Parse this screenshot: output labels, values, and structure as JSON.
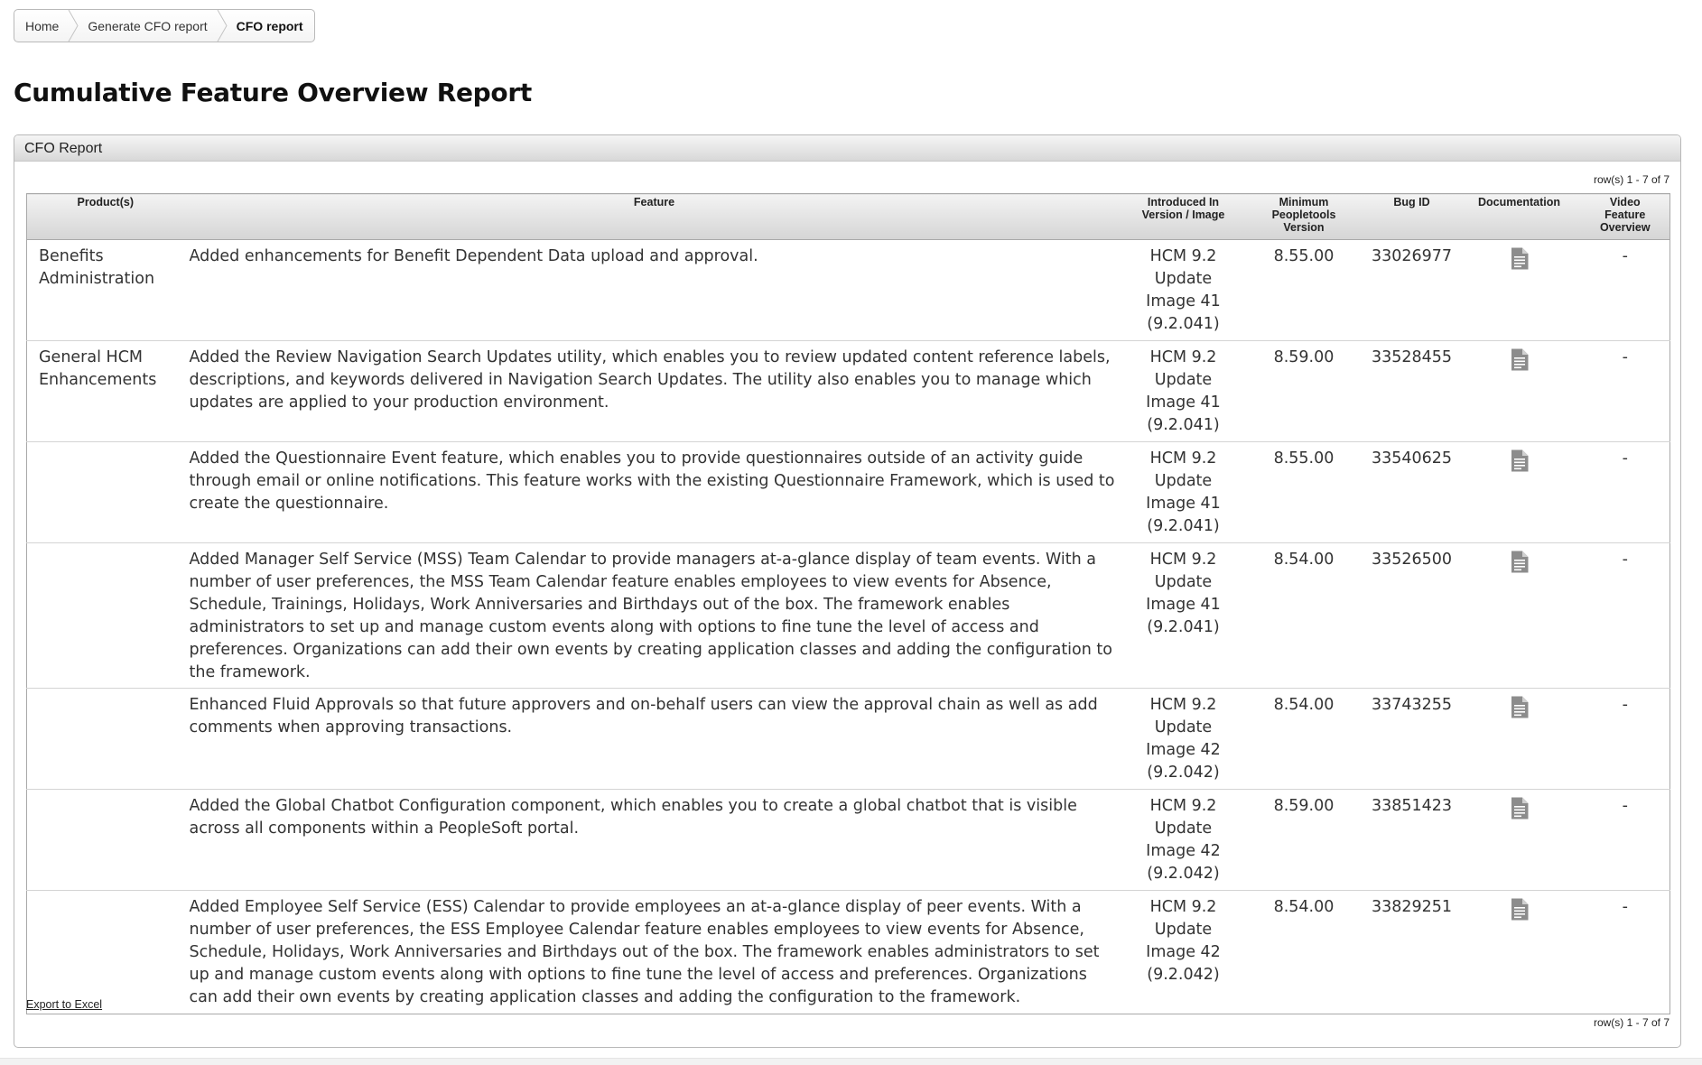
{
  "breadcrumb": {
    "items": [
      "Home",
      "Generate CFO report",
      "CFO report"
    ]
  },
  "page_title": "Cumulative Feature Overview Report",
  "panel": {
    "title": "CFO Report",
    "row_count_top": "row(s) 1 - 7 of 7",
    "row_count_bottom": "row(s) 1 - 7 of 7",
    "export_label": "Export to Excel"
  },
  "table": {
    "headers": {
      "product": "Product(s)",
      "feature": "Feature",
      "introduced_1": "Introduced In",
      "introduced_2": "Version / Image",
      "min_pt_1": "Minimum",
      "min_pt_2": "Peopletools",
      "min_pt_3": "Version",
      "bug_id": "Bug ID",
      "documentation": "Documentation",
      "video_1": "Video",
      "video_2": "Feature",
      "video_3": "Overview"
    },
    "rows": [
      {
        "product_1": "Benefits",
        "product_2": "Administration",
        "feature": "Added enhancements for Benefit Dependent Data upload and approval.",
        "intro_1": "HCM 9.2",
        "intro_2": "Update",
        "intro_3": "Image 41",
        "intro_4": "(9.2.041)",
        "min_pt": "8.55.00",
        "bug_id": "33026977",
        "video": "-"
      },
      {
        "product_1": "General HCM",
        "product_2": "Enhancements",
        "feature": "Added the Review Navigation Search Updates utility, which enables you to review updated content reference labels, descriptions, and keywords delivered in Navigation Search Updates. The utility also enables you to manage which updates are applied to your production environment.",
        "intro_1": "HCM 9.2",
        "intro_2": "Update",
        "intro_3": "Image 41",
        "intro_4": "(9.2.041)",
        "min_pt": "8.59.00",
        "bug_id": "33528455",
        "video": "-"
      },
      {
        "product_1": "",
        "product_2": "",
        "feature": "Added the Questionnaire Event feature, which enables you to provide questionnaires outside of an activity guide through email or online notifications. This feature works with the existing Questionnaire Framework, which is used to create the questionnaire.",
        "intro_1": "HCM 9.2",
        "intro_2": "Update",
        "intro_3": "Image 41",
        "intro_4": "(9.2.041)",
        "min_pt": "8.55.00",
        "bug_id": "33540625",
        "video": "-"
      },
      {
        "product_1": "",
        "product_2": "",
        "feature": "Added Manager Self Service (MSS) Team Calendar to provide managers at-a-glance display of team events. With a number of user preferences, the MSS Team Calendar feature enables employees to view events for Absence, Schedule, Trainings, Holidays, Work Anniversaries and Birthdays out of the box. The framework enables administrators to set up and manage custom events along with options to fine tune the level of access and preferences. Organizations can add their own events by creating application classes and adding the configuration to the framework.",
        "intro_1": "HCM 9.2",
        "intro_2": "Update",
        "intro_3": "Image 41",
        "intro_4": "(9.2.041)",
        "min_pt": "8.54.00",
        "bug_id": "33526500",
        "video": "-"
      },
      {
        "product_1": "",
        "product_2": "",
        "feature": "Enhanced Fluid Approvals so that future approvers and on-behalf users can view the approval chain as well as add comments when approving transactions.",
        "intro_1": "HCM 9.2",
        "intro_2": "Update",
        "intro_3": "Image 42",
        "intro_4": "(9.2.042)",
        "min_pt": "8.54.00",
        "bug_id": "33743255",
        "video": "-"
      },
      {
        "product_1": "",
        "product_2": "",
        "feature": "Added the Global Chatbot Configuration component, which enables you to create a global chatbot that is visible across all components within a PeopleSoft portal.",
        "intro_1": "HCM 9.2",
        "intro_2": "Update",
        "intro_3": "Image 42",
        "intro_4": "(9.2.042)",
        "min_pt": "8.59.00",
        "bug_id": "33851423",
        "video": "-"
      },
      {
        "product_1": "",
        "product_2": "",
        "feature": "Added Employee Self Service (ESS) Calendar to provide employees an at-a-glance display of peer events. With a number of user preferences, the ESS Employee Calendar feature enables employees to view events for Absence, Schedule, Holidays, Work Anniversaries and Birthdays out of the box. The framework enables administrators to set up and manage custom events along with options to fine tune the level of access and preferences. Organizations can add their own events by creating application classes and adding the configuration to the framework.",
        "intro_1": "HCM 9.2",
        "intro_2": "Update",
        "intro_3": "Image 42",
        "intro_4": "(9.2.042)",
        "min_pt": "8.54.00",
        "bug_id": "33829251",
        "video": "-"
      }
    ]
  },
  "icons": {
    "documentation": "document-icon"
  },
  "colors": {
    "header_gradient_top": "#f3f3f3",
    "header_gradient_bottom": "#d5d5d5",
    "border": "#a9a9a9",
    "icon": "#8a8a8a"
  }
}
